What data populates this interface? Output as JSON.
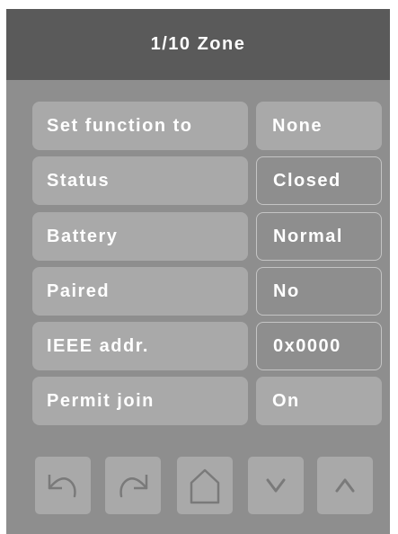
{
  "header": {
    "title": "1/10 Zone"
  },
  "rows": [
    {
      "label": "Set function to",
      "value": "None"
    },
    {
      "label": "Status",
      "value": "Closed"
    },
    {
      "label": "Battery",
      "value": "Normal"
    },
    {
      "label": "Paired",
      "value": "No"
    },
    {
      "label": "IEEE addr.",
      "value": "0x0000"
    },
    {
      "label": "Permit join",
      "value": "On"
    }
  ],
  "nav": {
    "icons": [
      "undo-icon",
      "redo-icon",
      "home-icon",
      "chevron-down-icon",
      "chevron-up-icon"
    ]
  },
  "colors": {
    "background": "#8e8e8e",
    "header": "#5a5a5a",
    "button": "#a9a9a9",
    "text": "#ffffff",
    "icon": "#7a7a7a"
  }
}
